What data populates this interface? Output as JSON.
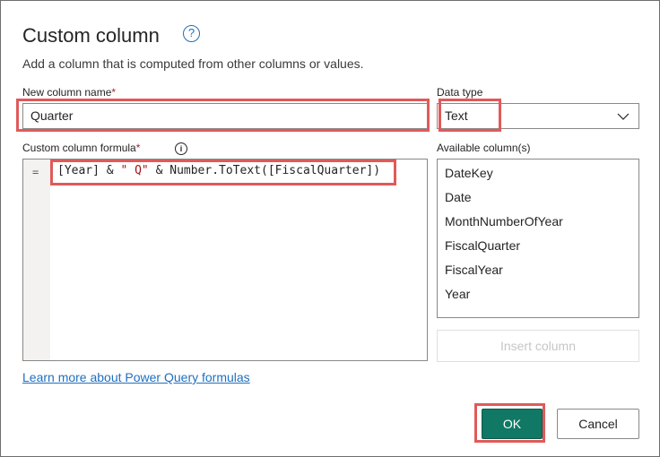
{
  "dialog": {
    "title": "Custom column",
    "help_icon": "question-circle-icon",
    "subtitle": "Add a column that is computed from other columns or values."
  },
  "new_column": {
    "label": "New column name",
    "required_mark": "*",
    "value": "Quarter"
  },
  "data_type": {
    "label": "Data type",
    "value": "Text"
  },
  "formula": {
    "label": "Custom column formula",
    "required_mark": "*",
    "info_glyph": "i",
    "line_prefix": "=",
    "code_part1": "[Year] & ",
    "code_string": "\" Q\"",
    "code_part2": " & Number.ToText([FiscalQuarter])"
  },
  "available": {
    "label": "Available column(s)",
    "items": [
      "DateKey",
      "Date",
      "MonthNumberOfYear",
      "FiscalQuarter",
      "FiscalYear",
      "Year"
    ],
    "insert_label": "Insert column"
  },
  "learn_more": "Learn more about Power Query formulas",
  "buttons": {
    "ok": "OK",
    "cancel": "Cancel"
  },
  "colors": {
    "primary": "#117865",
    "link": "#1f6fbf",
    "highlight": "#e05a5a",
    "required": "#a4262c"
  }
}
